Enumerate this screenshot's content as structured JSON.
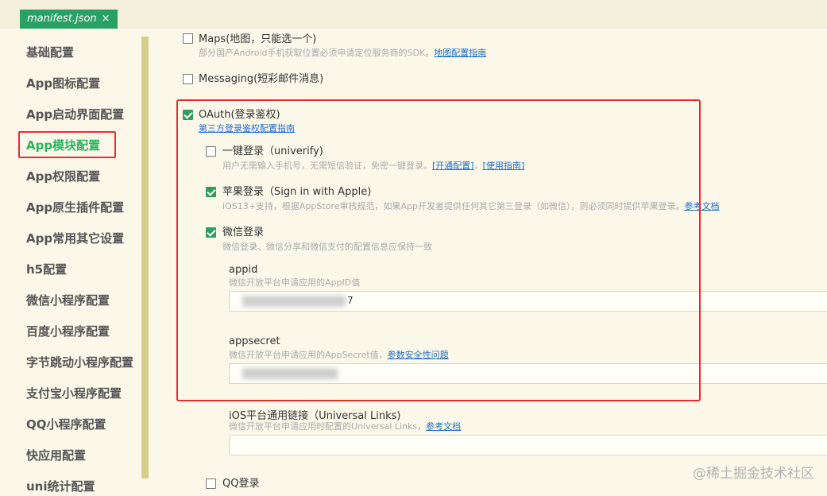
{
  "tab": {
    "title": "manifest.json",
    "close": "×"
  },
  "sidebar": {
    "items": [
      "基础配置",
      "App图标配置",
      "App启动界面配置",
      "App模块配置",
      "App权限配置",
      "App原生插件配置",
      "App常用其它设置",
      "h5配置",
      "微信小程序配置",
      "百度小程序配置",
      "字节跳动小程序配置",
      "支付宝小程序配置",
      "QQ小程序配置",
      "快应用配置",
      "uni统计配置"
    ],
    "active_index": 3
  },
  "content": {
    "maps": {
      "label": "Maps(地图，只能选一个)",
      "desc": "部分国产Android手机获取位置必须申请定位服务商的SDK。",
      "link": "地图配置指南",
      "checked": false
    },
    "messaging": {
      "label": "Messaging(短彩邮件消息)",
      "checked": false
    },
    "oauth": {
      "label": "OAuth(登录鉴权)",
      "link": "第三方登录鉴权配置指南",
      "checked": true,
      "univerify": {
        "label": "一键登录（univerify)",
        "desc": "用户无需输入手机号，无需短信验证，免密一键登录。",
        "link1": "[开通配置]",
        "sep": "，",
        "link2": "[使用指南]",
        "checked": false
      },
      "apple": {
        "label": "苹果登录（Sign in with Apple)",
        "desc": "iOS13+支持，根据AppStore审核规范，如果App开发者提供任何其它第三登录（如微信），则必须同时提供苹果登录。",
        "link": "参考文档",
        "checked": true
      },
      "weixin": {
        "label": "微信登录",
        "desc": "微信登录、微信分享和微信支付的配置信息应保持一致",
        "checked": true,
        "appid": {
          "label": "appid",
          "desc": "微信开放平台申请应用的AppID值",
          "value_tail": "7"
        },
        "appsecret": {
          "label": "appsecret",
          "desc": "微信开放平台申请应用的AppSecret值，",
          "link": "参数安全性问题"
        }
      }
    },
    "universal_links": {
      "label": "iOS平台通用链接（Universal Links)",
      "desc": "微信开放平台申请应用时配置的Universal Links，",
      "link": "参考文档"
    },
    "qq": {
      "label": "QQ登录",
      "checked": false
    }
  },
  "watermark": "@稀土掘金技术社区",
  "colors": {
    "accent": "#29a164",
    "highlight": "#e03131",
    "link": "#1e6fc0"
  }
}
